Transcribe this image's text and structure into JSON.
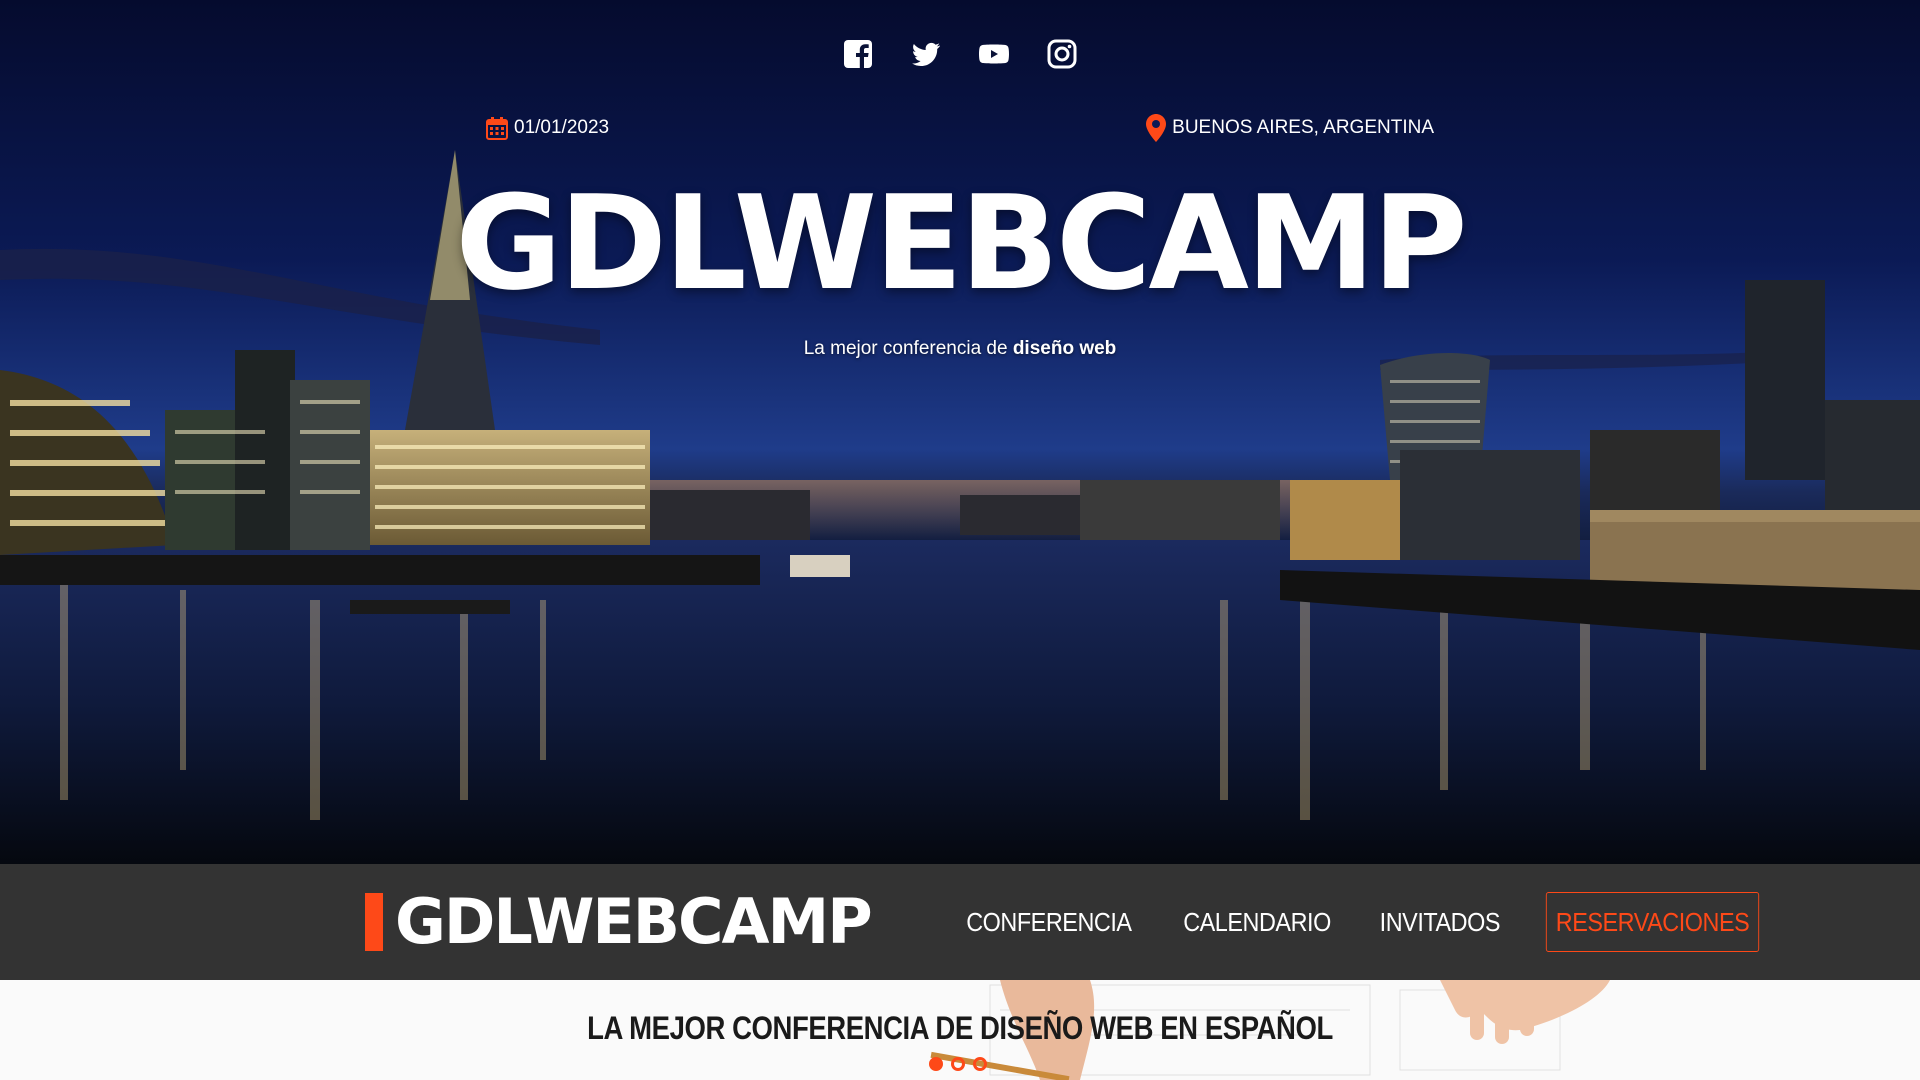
{
  "hero": {
    "social": [
      {
        "name": "facebook-icon"
      },
      {
        "name": "twitter-icon"
      },
      {
        "name": "youtube-icon"
      },
      {
        "name": "instagram-icon"
      }
    ],
    "date": "01/01/2023",
    "location": "BUENOS AIRES, ARGENTINA",
    "title": "GDLWEBCAMP",
    "tagline_prefix": "La mejor conferencia de ",
    "tagline_bold": "diseño web"
  },
  "navbar": {
    "logo": "GDLWEBCAMP",
    "items": [
      {
        "label": "CONFERENCIA"
      },
      {
        "label": "CALENDARIO"
      },
      {
        "label": "INVITADOS"
      },
      {
        "label": "RESERVACIONES"
      }
    ]
  },
  "section": {
    "heading": "LA MEJOR CONFERENCIA DE DISEÑO WEB EN ESPAÑOL",
    "slides": 3,
    "active_slide": 0
  },
  "colors": {
    "accent": "#fe4918",
    "navbar_bg": "#333333",
    "text_light": "#ffffff"
  }
}
